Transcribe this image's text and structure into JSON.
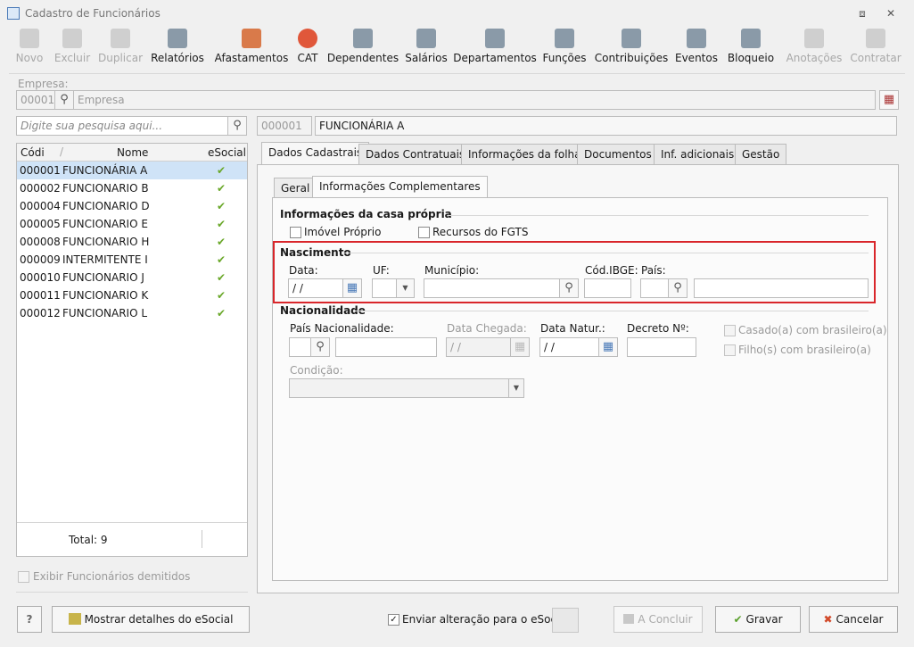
{
  "window": {
    "title": "Cadastro de Funcionários",
    "minimize": "⧈",
    "close": "✕"
  },
  "toolbar": [
    {
      "label": "Novo",
      "icon": "new-icon",
      "enabled": false
    },
    {
      "label": "Excluir",
      "icon": "trash-icon",
      "enabled": false
    },
    {
      "label": "Duplicar",
      "icon": "duplicate-icon",
      "enabled": false
    },
    {
      "label": "Relatórios",
      "icon": "report-icon",
      "enabled": true
    },
    {
      "label": "Afastamentos",
      "icon": "house-icon",
      "enabled": true
    },
    {
      "label": "CAT",
      "icon": "cross-icon",
      "enabled": true
    },
    {
      "label": "Dependentes",
      "icon": "people-icon",
      "enabled": true
    },
    {
      "label": "Salários",
      "icon": "money-icon",
      "enabled": true
    },
    {
      "label": "Departamentos",
      "icon": "desk-icon",
      "enabled": true
    },
    {
      "label": "Funções",
      "icon": "badge-icon",
      "enabled": true
    },
    {
      "label": "Contribuições",
      "icon": "contribution-icon",
      "enabled": true
    },
    {
      "label": "Eventos",
      "icon": "list-icon",
      "enabled": true
    },
    {
      "label": "Bloqueio",
      "icon": "lock-icon",
      "enabled": true
    },
    {
      "label": "Anotações",
      "icon": "notes-icon",
      "enabled": false
    },
    {
      "label": "Contratar",
      "icon": "hire-icon",
      "enabled": false
    }
  ],
  "empresa": {
    "label": "Empresa:",
    "code": "00001",
    "name": "Empresa"
  },
  "search": {
    "placeholder": "Digite sua pesquisa aqui..."
  },
  "employee": {
    "code": "000001",
    "name": "FUNCIONÁRIA A"
  },
  "grid": {
    "headers": [
      "Códi",
      "Nome",
      "eSocial"
    ],
    "rows": [
      {
        "code": "000001",
        "name": "FUNCIONÁRIA A"
      },
      {
        "code": "000002",
        "name": "FUNCIONARIO B"
      },
      {
        "code": "000004",
        "name": "FUNCIONARIO D"
      },
      {
        "code": "000005",
        "name": "FUNCIONARIO E"
      },
      {
        "code": "000008",
        "name": "FUNCIONARIO H"
      },
      {
        "code": "000009",
        "name": "INTERMITENTE I"
      },
      {
        "code": "000010",
        "name": "FUNCIONARIO J"
      },
      {
        "code": "000011",
        "name": "FUNCIONARIO K"
      },
      {
        "code": "000012",
        "name": "FUNCIONARIO L"
      }
    ],
    "total": "Total: 9",
    "check": "✔"
  },
  "show_dismissed": "Exibir Funcionários demitidos",
  "tabs": [
    "Dados Cadastrais",
    "Dados Contratuais",
    "Informações da folha",
    "Documentos",
    "Inf. adicionais",
    "Gestão"
  ],
  "subtabs": [
    "Geral",
    "Informações Complementares"
  ],
  "casa_propria": {
    "title": "Informações da casa própria",
    "imovel": "Imóvel Próprio",
    "fgts": "Recursos do FGTS"
  },
  "nascimento": {
    "title": "Nascimento",
    "data_label": "Data:",
    "data_value": " / /",
    "uf_label": "UF:",
    "municipio_label": "Município:",
    "ibge_label": "Cód.IBGE:",
    "pais_label": "País:"
  },
  "nacionalidade": {
    "title": "Nacionalidade",
    "pais_label": "País Nacionalidade:",
    "chegada_label": "Data Chegada:",
    "chegada_value": " / /",
    "natur_label": "Data Natur.:",
    "natur_value": " / /",
    "decreto_label": "Decreto Nº:",
    "casado": "Casado(a) com brasileiro(a)",
    "filho": "Filho(s) com brasileiro(a)",
    "condicao_label": "Condição:"
  },
  "footer": {
    "help": "?",
    "esocial_details": "Mostrar detalhes do eSocial",
    "send_change": "Enviar alteração para o eSocial",
    "concluir": "A Concluir",
    "gravar": "Gravar",
    "cancelar": "Cancelar"
  }
}
